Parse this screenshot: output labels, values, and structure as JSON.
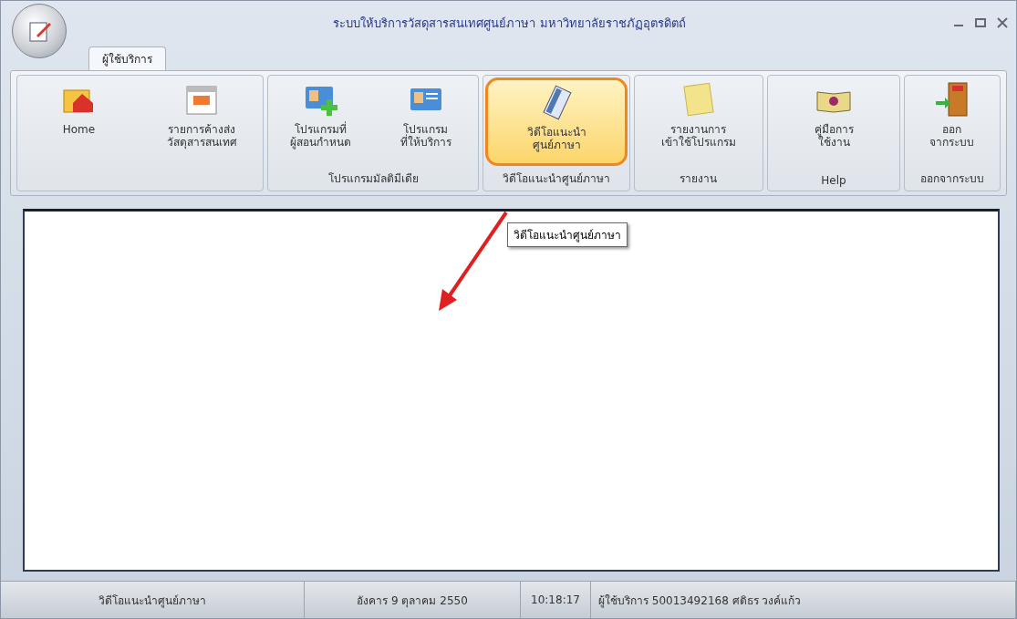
{
  "window": {
    "title": "ระบบให้บริการวัสดุสารสนเทศศูนย์ภาษา มหาวิทยาลัยราชภัฏอุตรดิตถ์"
  },
  "tabs": [
    {
      "label": "ผู้ใช้บริการ",
      "selected": true
    }
  ],
  "ribbon": {
    "groups": [
      {
        "buttons": [
          {
            "kind": "home",
            "label": "Home",
            "selected": false
          },
          {
            "kind": "calendar",
            "label": "รายการค้างส่ง\nวัสดุสารสนเทศ",
            "selected": false
          }
        ]
      },
      {
        "label": "โปรแกรมมัลติมีเดีย",
        "buttons": [
          {
            "kind": "card-add",
            "label": "โปรแกรมที่\nผู้สอนกำหนด",
            "selected": false
          },
          {
            "kind": "card",
            "label": "โปรแกรม\nที่ให้บริการ",
            "selected": false
          }
        ]
      },
      {
        "label": "วิดีโอแนะนำศูนย์ภาษา",
        "buttons": [
          {
            "kind": "video",
            "label": "วิดีโอแนะนำ\nศูนย์ภาษา",
            "selected": true
          }
        ]
      },
      {
        "label": "รายงาน",
        "buttons": [
          {
            "kind": "note",
            "label": "รายงานการ\nเข้าใช้โปรแกรม",
            "selected": false
          }
        ]
      },
      {
        "label": "Help",
        "buttons": [
          {
            "kind": "book",
            "label": "คู่มือการ\nใช้งาน",
            "selected": false
          }
        ]
      },
      {
        "label": "ออกจากระบบ",
        "buttons": [
          {
            "kind": "exit",
            "label": "ออก\nจากระบบ",
            "selected": false
          }
        ]
      }
    ]
  },
  "tooltip": {
    "text": "วิดีโอแนะนำศูนย์ภาษา"
  },
  "status_bar": [
    "วิดีโอแนะนำศูนย์ภาษา",
    "อังคาร 9 ตุลาคม 2550",
    "10:18:17",
    "ผู้ใช้บริการ 50013492168 ศดิธร วงค์แก้ว"
  ]
}
